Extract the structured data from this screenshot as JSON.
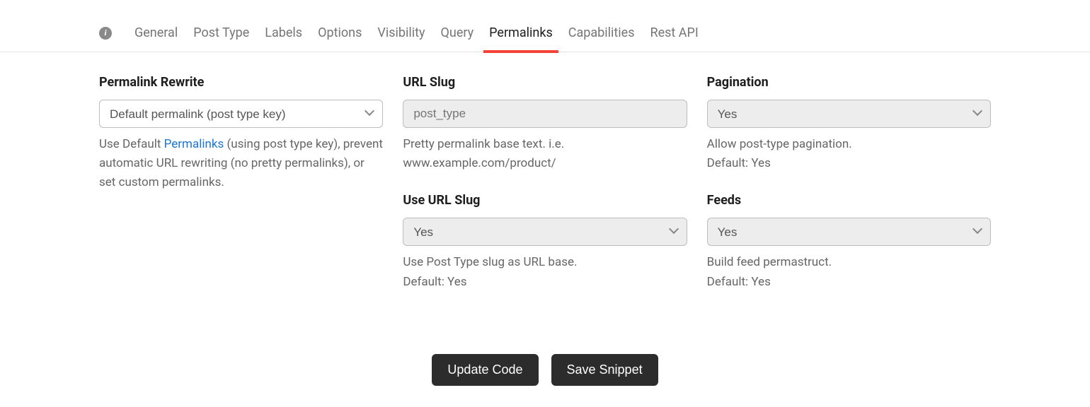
{
  "info_icon_label": "i",
  "tabs": [
    {
      "label": "General",
      "active": false
    },
    {
      "label": "Post Type",
      "active": false
    },
    {
      "label": "Labels",
      "active": false
    },
    {
      "label": "Options",
      "active": false
    },
    {
      "label": "Visibility",
      "active": false
    },
    {
      "label": "Query",
      "active": false
    },
    {
      "label": "Permalinks",
      "active": true
    },
    {
      "label": "Capabilities",
      "active": false
    },
    {
      "label": "Rest API",
      "active": false
    }
  ],
  "col1": {
    "permalink_rewrite": {
      "label": "Permalink Rewrite",
      "selected": "Default permalink (post type key)",
      "help_pre": "Use Default ",
      "help_link": "Permalinks",
      "help_post": " (using post type key), prevent automatic URL rewriting (no pretty permalinks), or set custom permalinks."
    }
  },
  "col2": {
    "url_slug": {
      "label": "URL Slug",
      "placeholder": "post_type",
      "value": "",
      "help": "Pretty permalink base text. i.e. www.example.com/product/"
    },
    "use_url_slug": {
      "label": "Use URL Slug",
      "selected": "Yes",
      "help": "Use Post Type slug as URL base.",
      "default": "Default: Yes"
    }
  },
  "col3": {
    "pagination": {
      "label": "Pagination",
      "selected": "Yes",
      "help": "Allow post-type pagination.",
      "default": "Default: Yes"
    },
    "feeds": {
      "label": "Feeds",
      "selected": "Yes",
      "help": "Build feed permastruct.",
      "default": "Default: Yes"
    }
  },
  "actions": {
    "update": "Update Code",
    "save": "Save Snippet"
  }
}
